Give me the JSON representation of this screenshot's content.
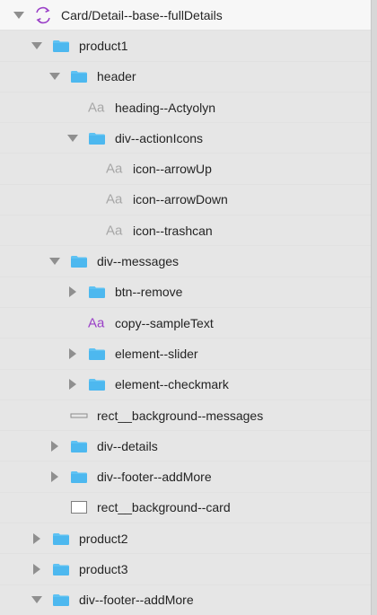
{
  "layers": [
    {
      "label": "Card/Detail--base--fullDetails",
      "kind": "symbol",
      "disclosure": "down",
      "icon": "refresh-symbol-icon",
      "depth": 0,
      "selected": false
    },
    {
      "label": "product1",
      "kind": "folder",
      "disclosure": "down",
      "icon": "folder-icon",
      "depth": 1,
      "selected": true
    },
    {
      "label": "header",
      "kind": "folder",
      "disclosure": "down",
      "icon": "folder-icon",
      "depth": 2,
      "selected": true
    },
    {
      "label": "heading--Actyolyn",
      "kind": "text",
      "disclosure": "",
      "icon": "text-layer-icon",
      "depth": 3,
      "selected": true
    },
    {
      "label": "div--actionIcons",
      "kind": "folder",
      "disclosure": "down",
      "icon": "folder-icon",
      "depth": 3,
      "selected": true
    },
    {
      "label": "icon--arrowUp",
      "kind": "text",
      "disclosure": "",
      "icon": "text-layer-icon",
      "depth": 4,
      "selected": true
    },
    {
      "label": "icon--arrowDown",
      "kind": "text",
      "disclosure": "",
      "icon": "text-layer-icon",
      "depth": 4,
      "selected": true
    },
    {
      "label": "icon--trashcan",
      "kind": "text",
      "disclosure": "",
      "icon": "text-layer-icon",
      "depth": 4,
      "selected": true
    },
    {
      "label": "div--messages",
      "kind": "folder",
      "disclosure": "down",
      "icon": "folder-icon",
      "depth": 2,
      "selected": true
    },
    {
      "label": "btn--remove",
      "kind": "folder",
      "disclosure": "right",
      "icon": "folder-icon",
      "depth": 3,
      "selected": true
    },
    {
      "label": "copy--sampleText",
      "kind": "text-accent",
      "disclosure": "",
      "icon": "text-style-icon",
      "depth": 3,
      "selected": true
    },
    {
      "label": "element--slider",
      "kind": "folder",
      "disclosure": "right",
      "icon": "folder-icon",
      "depth": 3,
      "selected": true
    },
    {
      "label": "element--checkmark",
      "kind": "folder",
      "disclosure": "right",
      "icon": "folder-icon",
      "depth": 3,
      "selected": true
    },
    {
      "label": "rect__background--messages",
      "kind": "rect-thin",
      "disclosure": "",
      "icon": "thin-rectangle-icon",
      "depth": 2,
      "selected": true
    },
    {
      "label": "div--details",
      "kind": "folder",
      "disclosure": "right",
      "icon": "folder-icon",
      "depth": 2,
      "selected": true
    },
    {
      "label": "div--footer--addMore",
      "kind": "folder",
      "disclosure": "right",
      "icon": "folder-icon",
      "depth": 2,
      "selected": true
    },
    {
      "label": "rect__background--card",
      "kind": "rect",
      "disclosure": "",
      "icon": "rectangle-icon",
      "depth": 2,
      "selected": true
    },
    {
      "label": "product2",
      "kind": "folder",
      "disclosure": "right",
      "icon": "folder-icon",
      "depth": 1,
      "selected": true
    },
    {
      "label": "product3",
      "kind": "folder",
      "disclosure": "right",
      "icon": "folder-icon",
      "depth": 1,
      "selected": true
    },
    {
      "label": "div--footer--addMore",
      "kind": "folder",
      "disclosure": "down",
      "icon": "folder-icon",
      "depth": 1,
      "selected": true
    }
  ]
}
